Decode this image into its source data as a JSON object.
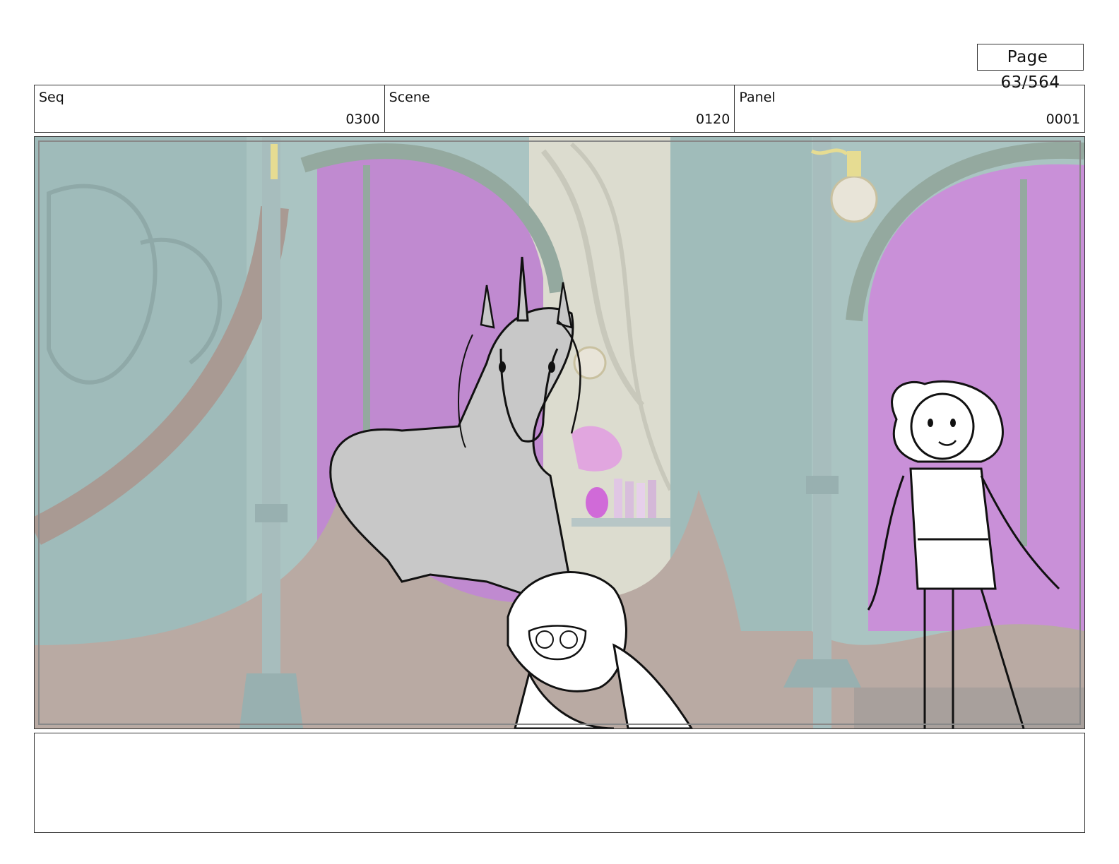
{
  "page": {
    "label": "Page",
    "number": "63/564"
  },
  "header": {
    "seq": {
      "label": "Seq",
      "value": "0300"
    },
    "scene": {
      "label": "Scene",
      "value": "0120"
    },
    "panel": {
      "label": "Panel",
      "value": "0001"
    }
  },
  "frame": {
    "description_icons": [
      "unicorn-sketch",
      "girl-crouching-sketch",
      "girl-standing-sketch"
    ],
    "colors": {
      "wall": "#a9c3c1",
      "window": "#c08ad0",
      "floor": "#b9aaa3",
      "pillar": "#a7bdbd",
      "lamp": "#e6dc92"
    }
  },
  "notes": {
    "text": ""
  }
}
